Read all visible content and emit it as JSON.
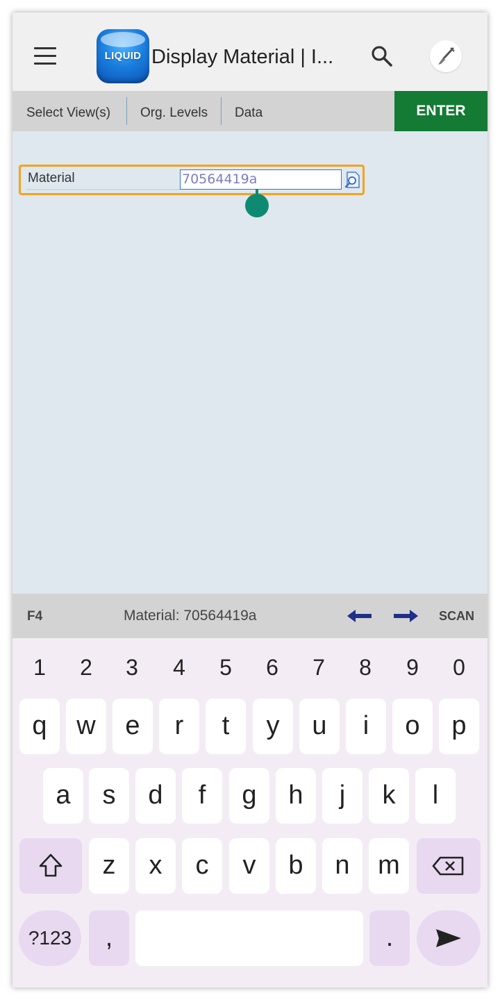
{
  "appbar": {
    "logo_text": "LIQUID",
    "title": "Display Material  | I...",
    "menu_icon": "hamburger-icon",
    "search_icon": "search-icon",
    "tool_icon": "brush-icon"
  },
  "tabs": {
    "select_views": "Select View(s)",
    "org_levels": "Org. Levels",
    "data": "Data",
    "enter": "ENTER"
  },
  "form": {
    "material_label": "Material",
    "material_value": "70564419a",
    "lookup_icon": "search-lookup-icon"
  },
  "status": {
    "f4": "F4",
    "text": "Material: 70564419a",
    "back_icon": "arrow-left-icon",
    "forward_icon": "arrow-right-icon",
    "scan": "SCAN"
  },
  "keyboard": {
    "numbers": [
      "1",
      "2",
      "3",
      "4",
      "5",
      "6",
      "7",
      "8",
      "9",
      "0"
    ],
    "row1": [
      "q",
      "w",
      "e",
      "r",
      "t",
      "y",
      "u",
      "i",
      "o",
      "p"
    ],
    "row2": [
      "a",
      "s",
      "d",
      "f",
      "g",
      "h",
      "j",
      "k",
      "l"
    ],
    "row3": [
      "z",
      "x",
      "c",
      "v",
      "b",
      "n",
      "m"
    ],
    "symbols": "?123",
    "comma": ",",
    "period": ".",
    "shift_icon": "shift-icon",
    "backspace_icon": "backspace-icon",
    "send_icon": "send-icon"
  },
  "colors": {
    "enter_green": "#137b33",
    "highlight_orange": "#f5a21e",
    "cursor_teal": "#0e8a73",
    "arrow_navy": "#1f2f8a"
  }
}
